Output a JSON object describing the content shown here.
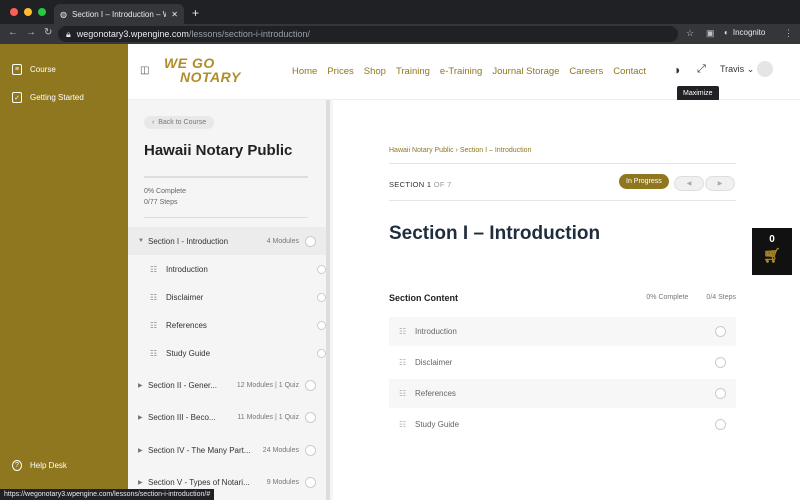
{
  "browser": {
    "tab_title": "Section I – Introduction – We G",
    "url_host": "wegonotary3.wpengine.com",
    "url_path": "/lessons/section-i-introduction/",
    "profile": "Incognito",
    "status_url": "https://wegonotary3.wpengine.com/lessons/section-i-introduction/#"
  },
  "leftbar": {
    "items": [
      {
        "label": "Course"
      },
      {
        "label": "Getting Started"
      }
    ],
    "help": "Help Desk"
  },
  "header": {
    "logo_top": "WE GO",
    "logo_bottom": "NOTARY",
    "menu": [
      "Home",
      "Prices",
      "Shop",
      "Training",
      "e-Training",
      "Journal Storage",
      "Careers",
      "Contact"
    ],
    "user": "Travis",
    "tooltip": "Maximize"
  },
  "sidebar": {
    "back": "Back to Course",
    "title": "Hawaii Notary Public",
    "complete": "0% Complete",
    "steps": "0/77 Steps",
    "sections": [
      {
        "name": "Section I - Introduction",
        "meta": "4 Modules"
      },
      {
        "name": "Section II - Gener...",
        "meta": "12 Modules  |  1 Quiz"
      },
      {
        "name": "Section III - Beco...",
        "meta": "11 Modules  |  1 Quiz"
      },
      {
        "name": "Section IV - The Many Part...",
        "meta": "24 Modules"
      },
      {
        "name": "Section V - Types of Notari...",
        "meta": "9 Modules"
      }
    ],
    "lessons": [
      "Introduction",
      "Disclaimer",
      "References",
      "Study Guide"
    ]
  },
  "main": {
    "crumb_course": "Hawaii Notary Public",
    "crumb_sep": "›",
    "crumb_section": "Section I – Introduction",
    "section_label": "SECTION 1",
    "section_of": "OF 7",
    "badge": "In Progress",
    "title": "Section I – Introduction",
    "content_title": "Section Content",
    "content_complete": "0% Complete",
    "content_steps": "0/4 Steps",
    "rows": [
      "Introduction",
      "Disclaimer",
      "References",
      "Study Guide"
    ]
  },
  "cart": {
    "count": "0"
  },
  "colors": {
    "accent": "#8f7720",
    "logo": "#b08d2a"
  }
}
